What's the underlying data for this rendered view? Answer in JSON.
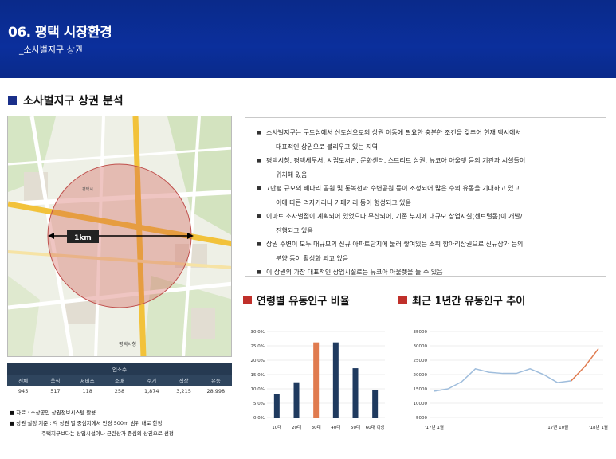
{
  "header": {
    "title": "06. 평택 시장환경",
    "subtitle": "_소사벌지구 상권"
  },
  "section": {
    "title": "소사벌지구 상권 분석"
  },
  "map": {
    "radius_label": "1km",
    "labels": [
      "평택시청",
      "평택시"
    ]
  },
  "stats_table": {
    "title": "업소수",
    "headers": [
      "전체",
      "음식",
      "서비스",
      "소매",
      "주거",
      "직장",
      "유동"
    ],
    "values": [
      "945",
      "517",
      "118",
      "258",
      "1,874",
      "3,215",
      "28,998"
    ]
  },
  "notes": {
    "line1": "■  자료 : 소상공인 상권정보시스템 활용",
    "line2": "■  상권 설정 기준 : 각 상권 별 중심지에서 반경 500m 범위 내로 한정",
    "line3": "주택지구보다는 상업시설이나 근린상가 중심의 상권으로 선정"
  },
  "description": {
    "items": [
      [
        "소사벌지구는 구도심에서 신도심으로의 상권 이동에 필요한 충분한 조건을 갖추어 현재 택시에서",
        "대표적인 상권으로 불리우고 있는 지역"
      ],
      [
        "평택시청, 평택세무서, 시립도서관, 문화센터, 스트리트 상권, 뉴코아 아울렛 등의 기관과 시설들이",
        "위치해 있음"
      ],
      [
        "7만평 규모의 배다리 공원 및 통복천과 수변공원 등이 조성되어 많은 수의 유동을 기대하고 있고",
        "이에 따른 먹자거리나 카페거리 등이 형성되고 있음"
      ],
      [
        "이마트 소사벌점이 계획되어 있었으나 무산되어, 기존 부지에 대규모 상업시설(센트럴돔)이 개발/",
        "진행되고 있음"
      ],
      [
        "상권 주변이 모두 대규모의 신규 아파트단지에 둘러 쌓여있는 소위 항아리상권으로 신규상가 등의",
        "분양 등이 활성화 되고 있음"
      ],
      [
        "이 상권의 가장 대표적인 상업시설로는 뉴코아 아울렛을 들 수 있음"
      ]
    ],
    "bullet": "■"
  },
  "chart_titles": {
    "left": "연령별 유동인구 비율",
    "right": "최근 1년간 유동인구 추이"
  },
  "colors": {
    "header_bg": "#0b2f9c",
    "bar": "#1f3a5f",
    "highlight": "#e07b4f",
    "line": "#9fbddc",
    "accent": "#c0302a"
  },
  "chart_data": [
    {
      "type": "bar",
      "title": "연령별 유동인구 비율",
      "categories": [
        "10대",
        "20대",
        "30대",
        "40대",
        "50대",
        "60대 이상"
      ],
      "values": [
        8.2,
        12.3,
        26.2,
        26.2,
        17.2,
        9.6
      ],
      "highlight_index": 2,
      "y_ticks": [
        "0.0%",
        "5.0%",
        "10.0%",
        "15.0%",
        "20.0%",
        "25.0%",
        "30.0%"
      ],
      "ylim": [
        0,
        30
      ],
      "grid": true
    },
    {
      "type": "line",
      "title": "최근 1년간 유동인구 추이",
      "x_tick_labels": [
        "'17년 1월",
        "'17년 10월",
        "'18년 1월"
      ],
      "values": [
        14200,
        15000,
        17500,
        22000,
        20800,
        20400,
        20400,
        22000,
        20000,
        17200,
        17800,
        22800,
        29000
      ],
      "highlight_from_index": 10,
      "y_ticks": [
        "5000",
        "10000",
        "15000",
        "20000",
        "25000",
        "30000",
        "35000"
      ],
      "ylim": [
        5000,
        35000
      ],
      "grid": true
    }
  ]
}
